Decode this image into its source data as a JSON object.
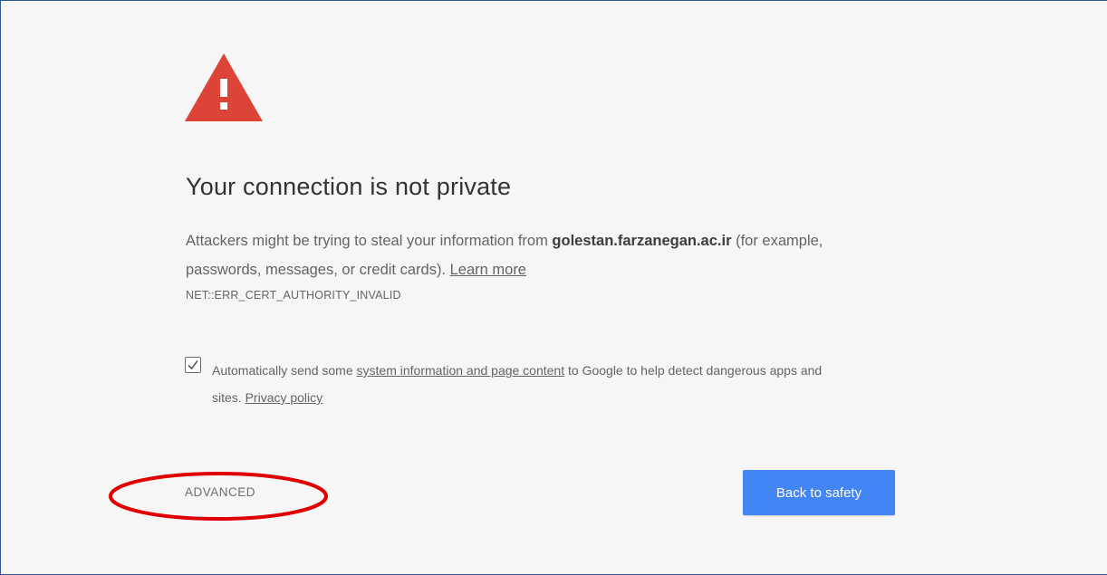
{
  "icons": {
    "warning": "warning-triangle-icon",
    "checkmark": "checkmark-icon"
  },
  "heading": "Your connection is not private",
  "description": {
    "prefix": "Attackers might be trying to steal your information from ",
    "domain": "golestan.farzanegan.ac.ir",
    "suffix": " (for example, passwords, messages, or credit cards). ",
    "learn_more": "Learn more"
  },
  "error_code": "NET::ERR_CERT_AUTHORITY_INVALID",
  "opt_in": {
    "checked": true,
    "prefix": "Automatically send some ",
    "link": "system information and page content",
    "middle": " to Google to help detect dangerous apps and sites. ",
    "privacy_link": "Privacy policy"
  },
  "buttons": {
    "advanced": "ADVANCED",
    "back_to_safety": "Back to safety"
  },
  "colors": {
    "page_background": "#f6f6f6",
    "warning_red": "#db4437",
    "primary_button": "#4285f4",
    "annotation_ellipse": "#e00000",
    "frame_border": "#2f5597"
  }
}
